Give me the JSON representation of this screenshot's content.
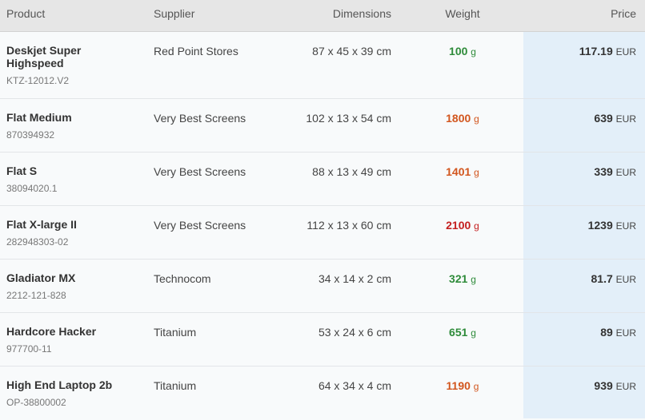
{
  "columns": {
    "product": "Product",
    "supplier": "Supplier",
    "dimensions": "Dimensions",
    "weight": "Weight",
    "price": "Price"
  },
  "weight_unit": "g",
  "currency": "EUR",
  "colors": {
    "weight_light": "#2e8b3a",
    "weight_medium": "#d2561e",
    "weight_heavy": "#c41f1f",
    "price_column_bg": "#e3eff9"
  },
  "rows": [
    {
      "name": "Deskjet Super Highspeed",
      "sku": "KTZ-12012.V2",
      "supplier": "Red Point Stores",
      "dimensions": "87 x 45 x 39 cm",
      "weight": "100",
      "price": "117.19"
    },
    {
      "name": "Flat Medium",
      "sku": "870394932",
      "supplier": "Very Best Screens",
      "dimensions": "102 x 13 x 54 cm",
      "weight": "1800",
      "price": "639"
    },
    {
      "name": "Flat S",
      "sku": "38094020.1",
      "supplier": "Very Best Screens",
      "dimensions": "88 x 13 x 49 cm",
      "weight": "1401",
      "price": "339"
    },
    {
      "name": "Flat X-large II",
      "sku": "282948303-02",
      "supplier": "Very Best Screens",
      "dimensions": "112 x 13 x 60 cm",
      "weight": "2100",
      "price": "1239"
    },
    {
      "name": "Gladiator MX",
      "sku": "2212-121-828",
      "supplier": "Technocom",
      "dimensions": "34 x 14 x 2 cm",
      "weight": "321",
      "price": "81.7"
    },
    {
      "name": "Hardcore Hacker",
      "sku": "977700-11",
      "supplier": "Titanium",
      "dimensions": "53 x 24 x 6 cm",
      "weight": "651",
      "price": "89"
    },
    {
      "name": "High End Laptop 2b",
      "sku": "OP-38800002",
      "supplier": "Titanium",
      "dimensions": "64 x 34 x 4 cm",
      "weight": "1190",
      "price": "939"
    }
  ]
}
